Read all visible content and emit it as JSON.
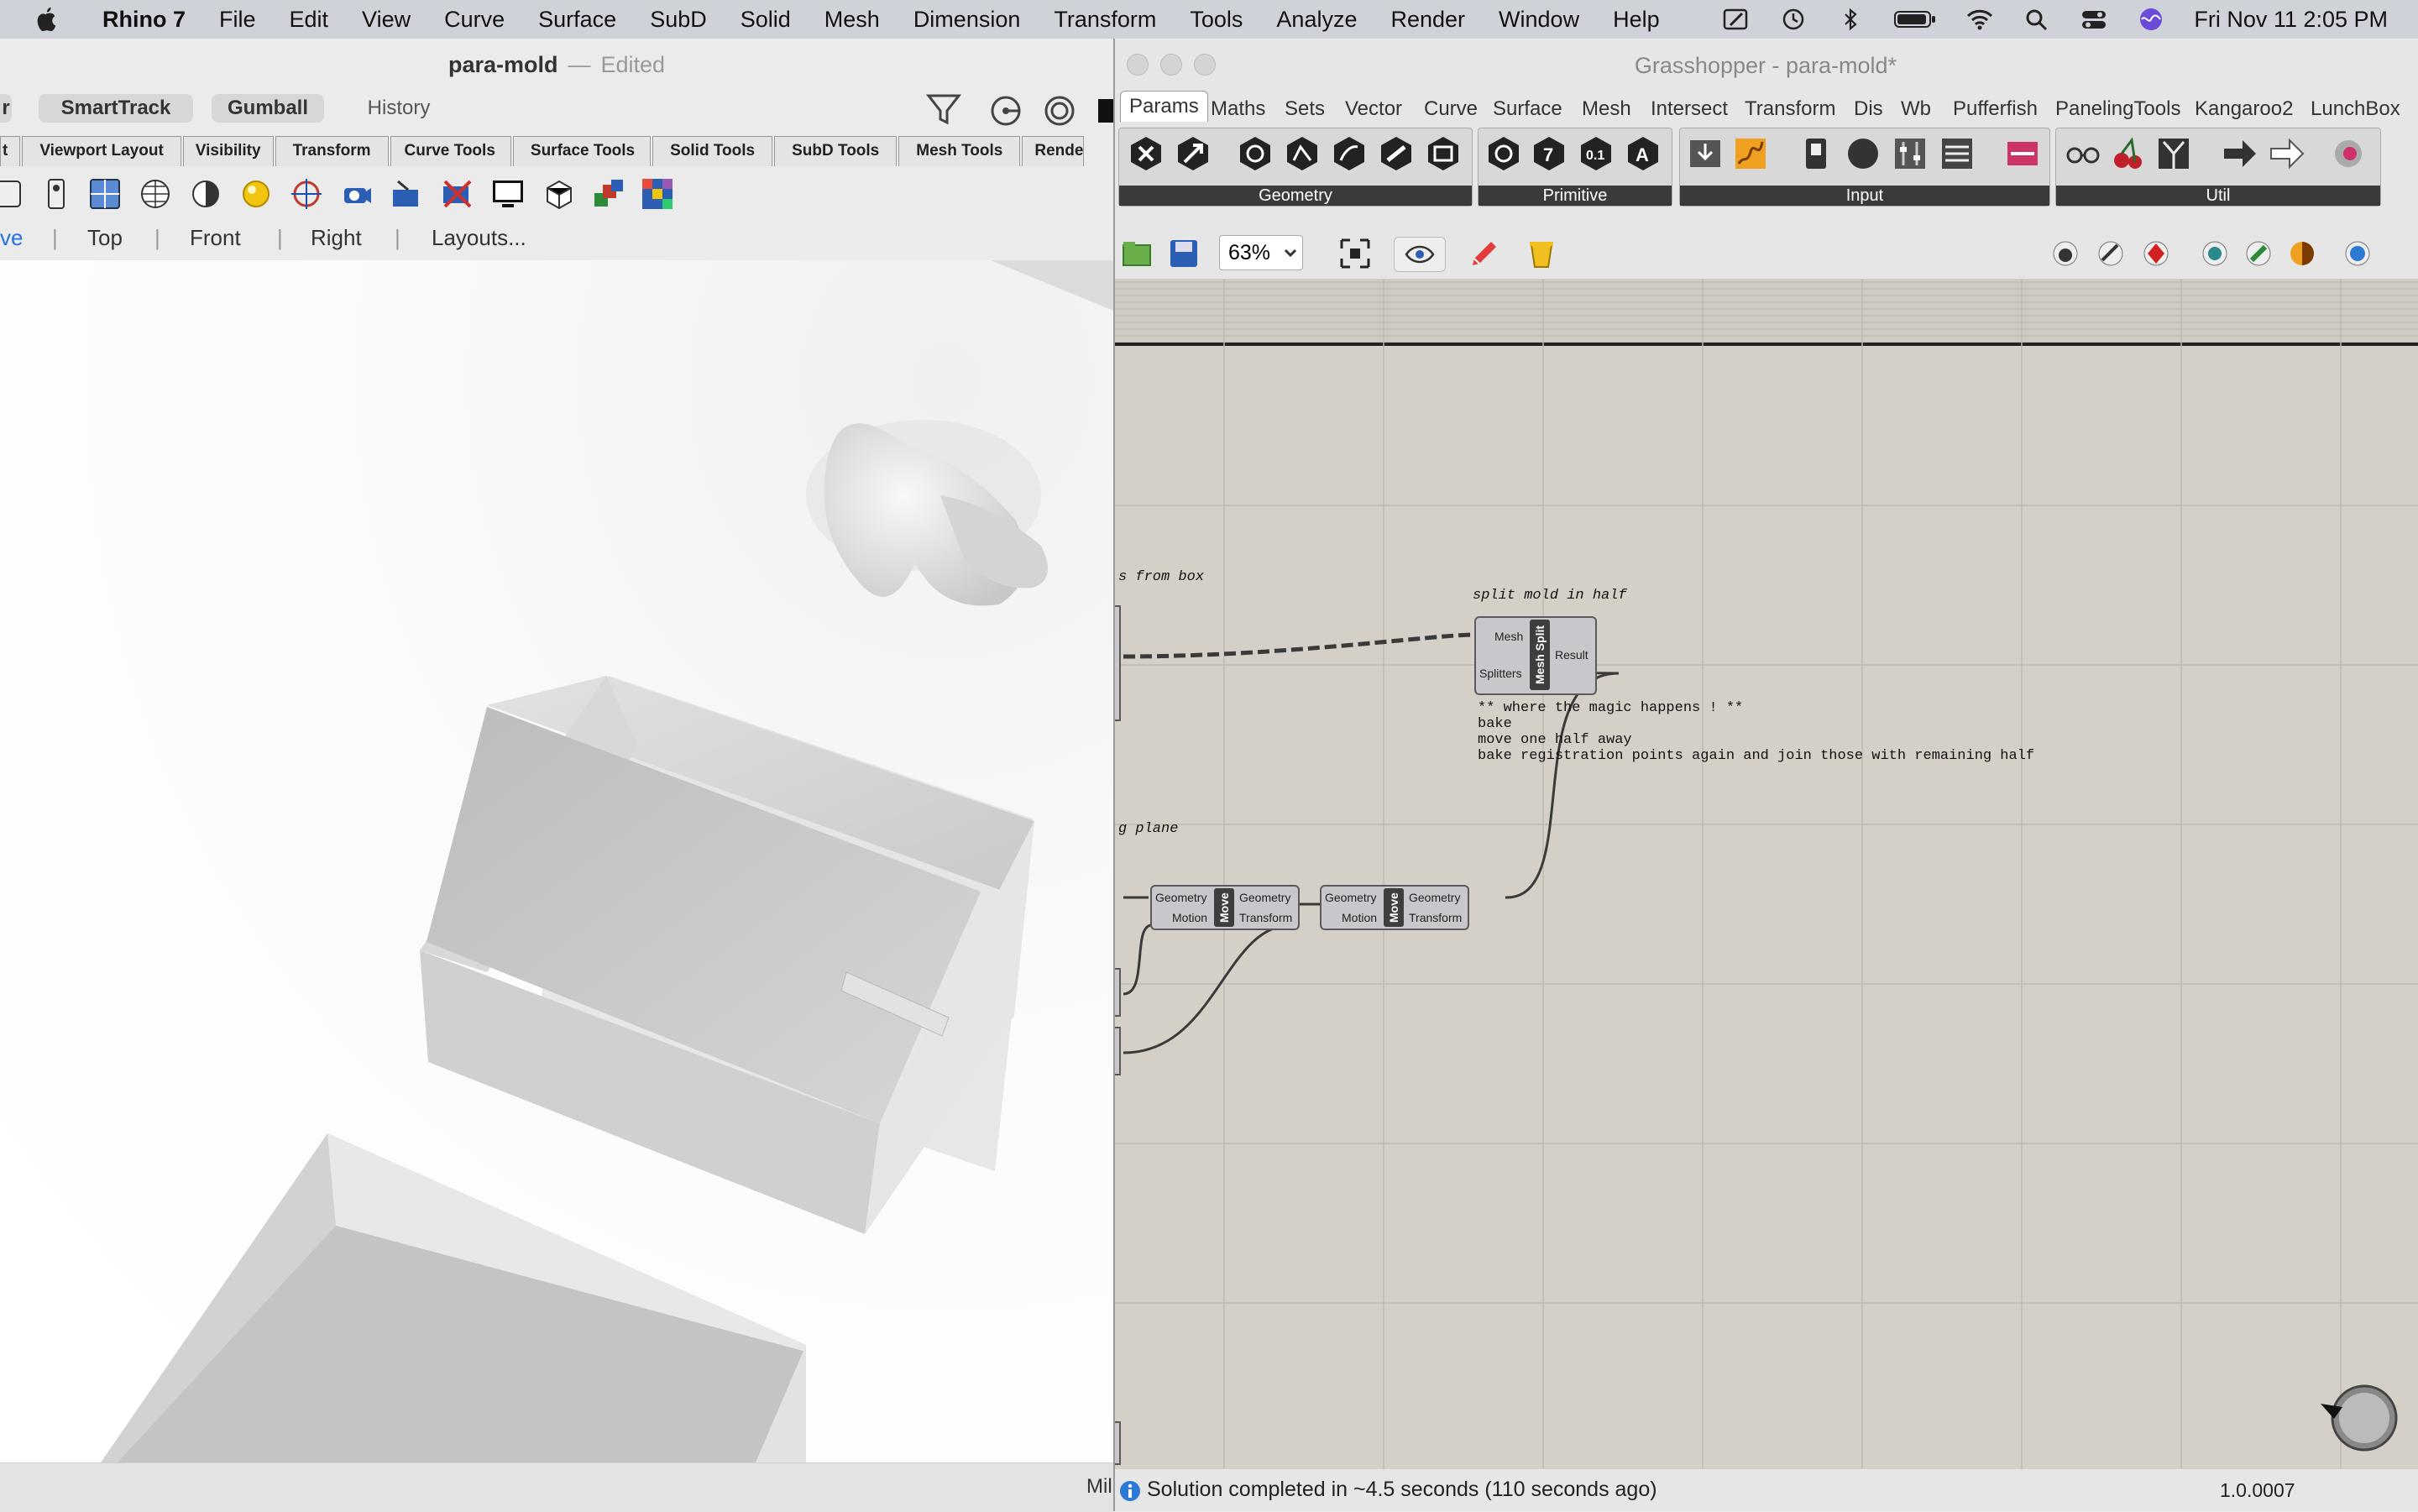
{
  "menubar": {
    "app": "Rhino 7",
    "items": [
      "File",
      "Edit",
      "View",
      "Curve",
      "Surface",
      "SubD",
      "Solid",
      "Mesh",
      "Dimension",
      "Transform",
      "Tools",
      "Analyze",
      "Render",
      "Window",
      "Help"
    ],
    "clock": "Fri Nov 11  2:05 PM",
    "icons": [
      "apple-icon",
      "pen-icon",
      "time-machine-icon",
      "bluetooth-icon",
      "battery-icon",
      "wifi-icon",
      "search-icon",
      "control-center-icon",
      "siri-icon"
    ]
  },
  "rhino": {
    "doc_title": "para-mold",
    "separator": "—",
    "doc_state": "Edited",
    "pills": [
      "SmartTrack",
      "Gumball"
    ],
    "history": "History",
    "left_pill_fragment": "r",
    "tabs": [
      "t",
      "Viewport Layout",
      "Visibility",
      "Transform",
      "Curve Tools",
      "Surface Tools",
      "Solid Tools",
      "SubD Tools",
      "Mesh Tools",
      "Rende"
    ],
    "view_tabs": [
      "ve",
      "Top",
      "Front",
      "Right",
      "Layouts..."
    ],
    "status_fragment": "Mil"
  },
  "gh": {
    "title": "Grasshopper - para-mold*",
    "tabs": [
      "Params",
      "Maths",
      "Sets",
      "Vector",
      "Curve",
      "Surface",
      "Mesh",
      "Intersect",
      "Transform",
      "Dis",
      "Wb",
      "Pufferfish",
      "PanelingTools",
      "Kangaroo2",
      "LunchBox"
    ],
    "panels": [
      "Geometry",
      "Primitive",
      "Input",
      "Util"
    ],
    "zoom": "63%",
    "notes": {
      "from_box": "s from box",
      "split": "split mold in half",
      "magic": "** where the magic happens ! **\nbake\nmove one half away\nbake registration points again and join those with remaining half",
      "plane": "g plane"
    },
    "mesh_split": {
      "name": "Mesh Split",
      "inputs": [
        "Mesh",
        "Splitters"
      ],
      "outputs": [
        "Result"
      ]
    },
    "move": {
      "name": "Move",
      "inputs": [
        "Geometry",
        "Motion"
      ],
      "outputs": [
        "Geometry",
        "Transform"
      ]
    },
    "status": "Solution completed in ~4.5 seconds (110 seconds ago)",
    "version": "1.0.0007"
  }
}
